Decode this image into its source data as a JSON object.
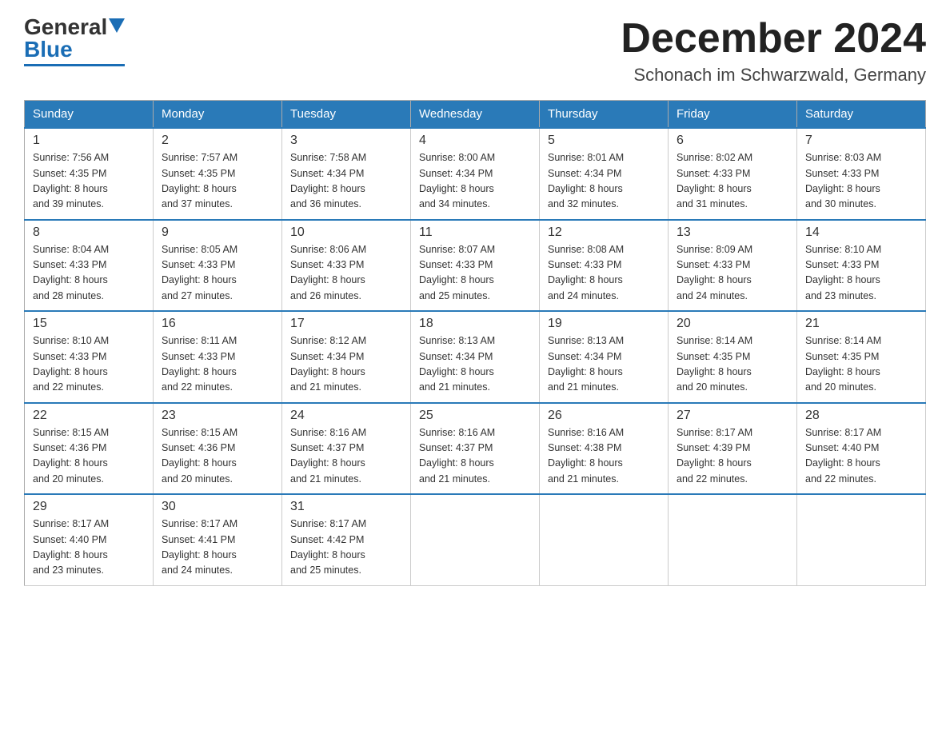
{
  "header": {
    "logo_general": "General",
    "logo_blue": "Blue",
    "month_title": "December 2024",
    "location": "Schonach im Schwarzwald, Germany"
  },
  "days_of_week": [
    "Sunday",
    "Monday",
    "Tuesday",
    "Wednesday",
    "Thursday",
    "Friday",
    "Saturday"
  ],
  "weeks": [
    [
      {
        "day": "1",
        "sunrise": "7:56 AM",
        "sunset": "4:35 PM",
        "daylight": "8 hours and 39 minutes."
      },
      {
        "day": "2",
        "sunrise": "7:57 AM",
        "sunset": "4:35 PM",
        "daylight": "8 hours and 37 minutes."
      },
      {
        "day": "3",
        "sunrise": "7:58 AM",
        "sunset": "4:34 PM",
        "daylight": "8 hours and 36 minutes."
      },
      {
        "day": "4",
        "sunrise": "8:00 AM",
        "sunset": "4:34 PM",
        "daylight": "8 hours and 34 minutes."
      },
      {
        "day": "5",
        "sunrise": "8:01 AM",
        "sunset": "4:34 PM",
        "daylight": "8 hours and 32 minutes."
      },
      {
        "day": "6",
        "sunrise": "8:02 AM",
        "sunset": "4:33 PM",
        "daylight": "8 hours and 31 minutes."
      },
      {
        "day": "7",
        "sunrise": "8:03 AM",
        "sunset": "4:33 PM",
        "daylight": "8 hours and 30 minutes."
      }
    ],
    [
      {
        "day": "8",
        "sunrise": "8:04 AM",
        "sunset": "4:33 PM",
        "daylight": "8 hours and 28 minutes."
      },
      {
        "day": "9",
        "sunrise": "8:05 AM",
        "sunset": "4:33 PM",
        "daylight": "8 hours and 27 minutes."
      },
      {
        "day": "10",
        "sunrise": "8:06 AM",
        "sunset": "4:33 PM",
        "daylight": "8 hours and 26 minutes."
      },
      {
        "day": "11",
        "sunrise": "8:07 AM",
        "sunset": "4:33 PM",
        "daylight": "8 hours and 25 minutes."
      },
      {
        "day": "12",
        "sunrise": "8:08 AM",
        "sunset": "4:33 PM",
        "daylight": "8 hours and 24 minutes."
      },
      {
        "day": "13",
        "sunrise": "8:09 AM",
        "sunset": "4:33 PM",
        "daylight": "8 hours and 24 minutes."
      },
      {
        "day": "14",
        "sunrise": "8:10 AM",
        "sunset": "4:33 PM",
        "daylight": "8 hours and 23 minutes."
      }
    ],
    [
      {
        "day": "15",
        "sunrise": "8:10 AM",
        "sunset": "4:33 PM",
        "daylight": "8 hours and 22 minutes."
      },
      {
        "day": "16",
        "sunrise": "8:11 AM",
        "sunset": "4:33 PM",
        "daylight": "8 hours and 22 minutes."
      },
      {
        "day": "17",
        "sunrise": "8:12 AM",
        "sunset": "4:34 PM",
        "daylight": "8 hours and 21 minutes."
      },
      {
        "day": "18",
        "sunrise": "8:13 AM",
        "sunset": "4:34 PM",
        "daylight": "8 hours and 21 minutes."
      },
      {
        "day": "19",
        "sunrise": "8:13 AM",
        "sunset": "4:34 PM",
        "daylight": "8 hours and 21 minutes."
      },
      {
        "day": "20",
        "sunrise": "8:14 AM",
        "sunset": "4:35 PM",
        "daylight": "8 hours and 20 minutes."
      },
      {
        "day": "21",
        "sunrise": "8:14 AM",
        "sunset": "4:35 PM",
        "daylight": "8 hours and 20 minutes."
      }
    ],
    [
      {
        "day": "22",
        "sunrise": "8:15 AM",
        "sunset": "4:36 PM",
        "daylight": "8 hours and 20 minutes."
      },
      {
        "day": "23",
        "sunrise": "8:15 AM",
        "sunset": "4:36 PM",
        "daylight": "8 hours and 20 minutes."
      },
      {
        "day": "24",
        "sunrise": "8:16 AM",
        "sunset": "4:37 PM",
        "daylight": "8 hours and 21 minutes."
      },
      {
        "day": "25",
        "sunrise": "8:16 AM",
        "sunset": "4:37 PM",
        "daylight": "8 hours and 21 minutes."
      },
      {
        "day": "26",
        "sunrise": "8:16 AM",
        "sunset": "4:38 PM",
        "daylight": "8 hours and 21 minutes."
      },
      {
        "day": "27",
        "sunrise": "8:17 AM",
        "sunset": "4:39 PM",
        "daylight": "8 hours and 22 minutes."
      },
      {
        "day": "28",
        "sunrise": "8:17 AM",
        "sunset": "4:40 PM",
        "daylight": "8 hours and 22 minutes."
      }
    ],
    [
      {
        "day": "29",
        "sunrise": "8:17 AM",
        "sunset": "4:40 PM",
        "daylight": "8 hours and 23 minutes."
      },
      {
        "day": "30",
        "sunrise": "8:17 AM",
        "sunset": "4:41 PM",
        "daylight": "8 hours and 24 minutes."
      },
      {
        "day": "31",
        "sunrise": "8:17 AM",
        "sunset": "4:42 PM",
        "daylight": "8 hours and 25 minutes."
      },
      null,
      null,
      null,
      null
    ]
  ],
  "labels": {
    "sunrise": "Sunrise:",
    "sunset": "Sunset:",
    "daylight": "Daylight:"
  }
}
